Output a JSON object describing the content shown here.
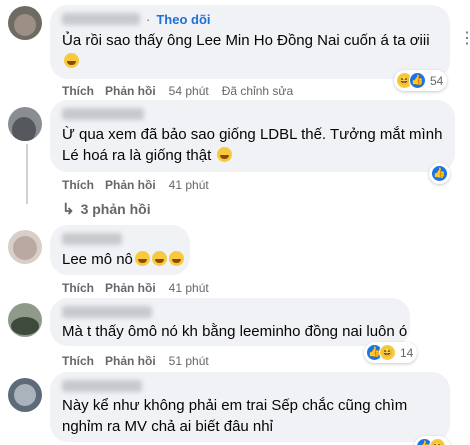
{
  "colors": {
    "bubble": "#f0f2f5",
    "link": "#216fdb",
    "muted": "#65676b",
    "like": "#1b74e4",
    "haha": "#f7c93e"
  },
  "comments": [
    {
      "follow_label": "Theo dõi",
      "separator": "·",
      "text_lines": [
        "Ủa rồi sao thấy ông Lee Min Ho Đồng Nai cuốn á ta ơiii",
        ""
      ],
      "emoji": "grinning-sweat",
      "like": "Thích",
      "reply": "Phản hồi",
      "time": "54 phút",
      "edited": "Đã chỉnh sửa",
      "reactions": {
        "icons": [
          "haha",
          "like"
        ],
        "count": "54"
      }
    },
    {
      "text_lines": [
        "Ừ qua xem đã bảo sao giống LDBL thế. Tưởng mắt mình",
        "Lé hoá ra là giống thật"
      ],
      "emoji": "rolling-laughing",
      "like": "Thích",
      "reply": "Phản hồi",
      "time": "41 phút",
      "reactions": {
        "icons": [
          "like"
        ],
        "count": ""
      }
    },
    {
      "text_lines": [
        "Lee mô nô"
      ],
      "emoji": "grinning x3",
      "like": "Thích",
      "reply": "Phản hồi",
      "time": "41 phút"
    },
    {
      "text_lines": [
        "Mà t thấy ômô nó kh bằng leeminho đồng nai luôn ó"
      ],
      "like": "Thích",
      "reply": "Phản hồi",
      "time": "51 phút",
      "reactions": {
        "icons": [
          "like",
          "haha"
        ],
        "count": "14"
      }
    },
    {
      "text_lines": [
        "Này kể như không phải em trai Sếp chắc cũng chìm",
        "nghỉm ra MV chả ai biết đâu nhỉ"
      ],
      "reactions": {
        "icons": [
          "like",
          "haha"
        ],
        "count": ""
      }
    }
  ],
  "view_replies": {
    "icon": "reply-arrow-icon",
    "label": "3 phản hồi"
  },
  "more_icon": "more-options-icon"
}
